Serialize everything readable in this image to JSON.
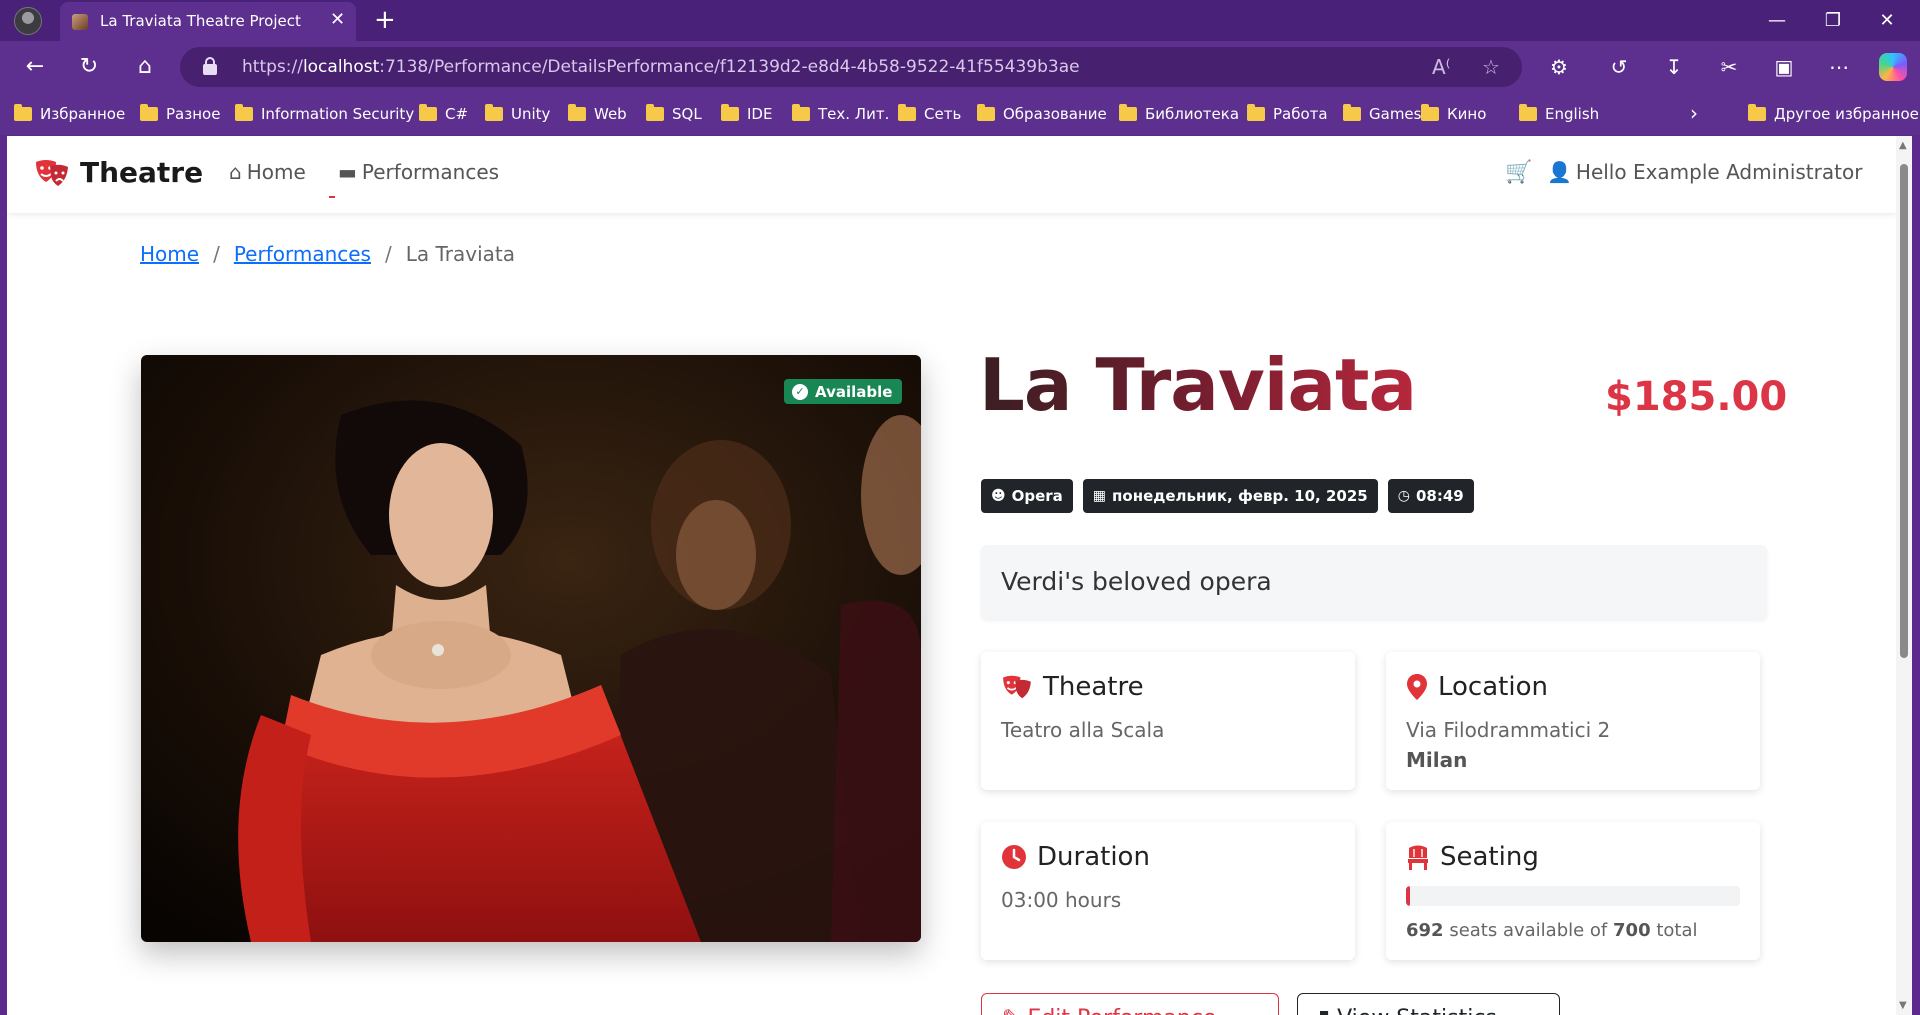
{
  "browser": {
    "tab_title": "La Traviata Theatre Project",
    "tab_close": "✕",
    "new_tab": "+",
    "window": {
      "minimize": "—",
      "maximize": "❐",
      "close": "✕"
    },
    "url_prefix": "https://",
    "url_host": "localhost",
    "url_rest": ":7138/Performance/DetailsPerformance/f12139d2-e8d4-4b58-9522-41f55439b3ae",
    "bookmarks": [
      "Избранное",
      "Разное",
      "Information Security",
      "C#",
      "Unity",
      "Web",
      "SQL",
      "IDE",
      "Тех. Лит.",
      "Сеть",
      "Образование",
      "Библиотека",
      "Работа",
      "Games",
      "Кино",
      "English"
    ],
    "other_bookmarks": "Другое избранное"
  },
  "nav": {
    "brand": "Theatre",
    "home": "Home",
    "performances": "Performances",
    "user": "Hello Example Administrator"
  },
  "breadcrumb": {
    "home": "Home",
    "performances": "Performances",
    "sep": "/",
    "current": "La Traviata"
  },
  "performance": {
    "status": "Available",
    "title": "La Traviata",
    "price": "$185.00",
    "genre": "Opera",
    "date": "понедельник, февр. 10, 2025",
    "time": "08:49",
    "description": "Verdi's beloved opera",
    "theatre_label": "Theatre",
    "theatre_name": "Teatro alla Scala",
    "location_label": "Location",
    "address": "Via Filodrammatici 2",
    "city": "Milan",
    "duration_label": "Duration",
    "duration": "03:00 hours",
    "seating_label": "Seating",
    "seats_available": "692",
    "seats_mid": "seats available of",
    "seats_total": "700",
    "seats_suffix": "total",
    "seats_booked_fraction": 0.0114
  },
  "actions": {
    "edit": "Edit Performance",
    "stats": "View Statistics"
  },
  "colors": {
    "accent": "#dc3545",
    "success": "#198754",
    "badge_dark": "#212529",
    "link": "#0d6efd",
    "browser_purple": "#5d2f8e"
  }
}
